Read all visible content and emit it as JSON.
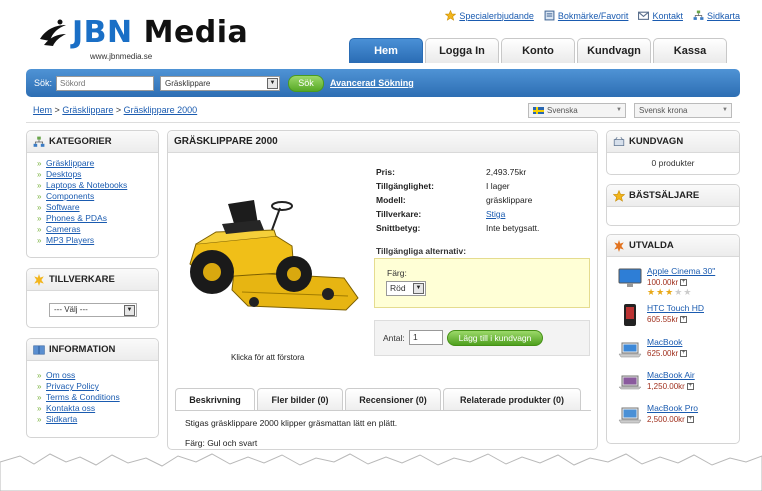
{
  "brand": {
    "logo_part1": "JBN",
    "logo_part2": " Media",
    "url": "www.jbnmedia.se"
  },
  "toplinks": [
    {
      "label": "Specialerbjudande",
      "icon": "star-icon"
    },
    {
      "label": "Bokmärke/Favorit",
      "icon": "bookmark-icon"
    },
    {
      "label": "Kontakt",
      "icon": "mail-icon"
    },
    {
      "label": "Sidkarta",
      "icon": "sitemap-icon"
    }
  ],
  "tabs": [
    {
      "label": "Hem",
      "active": true
    },
    {
      "label": "Logga In",
      "active": false
    },
    {
      "label": "Konto",
      "active": false
    },
    {
      "label": "Kundvagn",
      "active": false
    },
    {
      "label": "Kassa",
      "active": false
    }
  ],
  "search": {
    "label": "Sök:",
    "placeholder": "Sökord",
    "category": "Gräsklippare",
    "button": "Sök",
    "advanced": "Avancerad Sökning"
  },
  "breadcrumb": {
    "items": [
      "Hem",
      "Gräsklippare",
      "Gräsklippare 2000"
    ],
    "separator": ">"
  },
  "language": "Svenska",
  "currency": "Svensk krona",
  "categories": {
    "title": "KATEGORIER",
    "items": [
      "Gräsklippare",
      "Desktops",
      "Laptops & Notebooks",
      "Components",
      "Software",
      "Phones & PDAs",
      "Cameras",
      "MP3 Players"
    ]
  },
  "manufacturer": {
    "title": "TILLVERKARE",
    "select": "--- Välj ---"
  },
  "information": {
    "title": "INFORMATION",
    "items": [
      "Om oss",
      "Privacy Policy",
      "Terms & Conditions",
      "Kontakta oss",
      "Sidkarta"
    ]
  },
  "product": {
    "title": "GRÄSKLIPPARE 2000",
    "image_caption": "Klicka för att förstora",
    "specs": [
      {
        "key": "Pris:",
        "value": "2,493.75kr"
      },
      {
        "key": "Tillgänglighet:",
        "value": "I lager"
      },
      {
        "key": "Modell:",
        "value": "gräsklippare"
      },
      {
        "key": "Tillverkare:",
        "value": "Stiga"
      },
      {
        "key": "Snittbetyg:",
        "value": "Inte betygsatt."
      }
    ],
    "options_title": "Tillgängliga alternativ:",
    "color_label": "Färg:",
    "color_value": "Röd",
    "qty_label": "Antal:",
    "qty_value": "1",
    "add_button": "Lägg till i kundvagn",
    "tabs": [
      "Beskrivning",
      "Fler bilder (0)",
      "Recensioner (0)",
      "Relaterade produkter (0)"
    ],
    "description": [
      "Stigas gräsklippare 2000 klipper gräsmattan lätt en plätt.",
      "Färg: Gul och svart"
    ]
  },
  "cart": {
    "title": "KUNDVAGN",
    "text": "0 produkter"
  },
  "bestsellers": {
    "title": "BÄSTSÄLJARE"
  },
  "featured": {
    "title": "UTVALDA",
    "items": [
      {
        "name": "Apple Cinema 30\"",
        "price": "100.00kr",
        "rating": 3
      },
      {
        "name": "HTC Touch HD",
        "price": "605.55kr"
      },
      {
        "name": "MacBook",
        "price": "625.00kr"
      },
      {
        "name": "MacBook Air",
        "price": "1,250.00kr"
      },
      {
        "name": "MacBook Pro",
        "price": "2,500.00kr"
      }
    ]
  },
  "colors": {
    "brand_blue": "#1a6fc6",
    "bar_blue": "#2d6eb3",
    "button_green": "#57a826",
    "price_red": "#a0301e",
    "options_bg": "#ffffd6"
  }
}
